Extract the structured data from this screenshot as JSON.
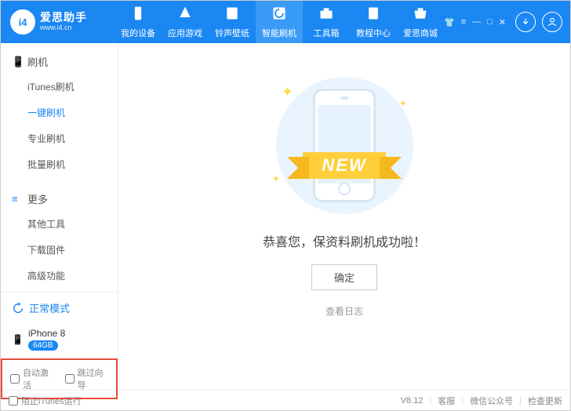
{
  "brand": {
    "logo_text": "i4",
    "name": "爱思助手",
    "url": "www.i4.cn"
  },
  "nav": [
    {
      "label": "我的设备",
      "icon": "device"
    },
    {
      "label": "应用游戏",
      "icon": "app"
    },
    {
      "label": "铃声壁纸",
      "icon": "music"
    },
    {
      "label": "智能刷机",
      "icon": "flash",
      "active": true
    },
    {
      "label": "工具箱",
      "icon": "toolbox"
    },
    {
      "label": "教程中心",
      "icon": "book"
    },
    {
      "label": "爱思商城",
      "icon": "shop"
    }
  ],
  "sidebar": {
    "sections": [
      {
        "title": "刷机",
        "items": [
          "iTunes刷机",
          "一键刷机",
          "专业刷机",
          "批量刷机"
        ],
        "active_index": 1
      },
      {
        "title": "更多",
        "items": [
          "其他工具",
          "下载固件",
          "高级功能"
        ]
      }
    ],
    "mode": "正常模式",
    "device": {
      "name": "iPhone 8",
      "storage": "64GB"
    },
    "checks": {
      "auto_activate": "自动激活",
      "skip_guide": "跳过向导"
    }
  },
  "main": {
    "ribbon": "NEW",
    "congrats": "恭喜您，保资料刷机成功啦！",
    "ok": "确定",
    "view_log": "查看日志"
  },
  "status": {
    "block_itunes": "阻止iTunes运行",
    "version": "V8.12",
    "right": [
      "客服",
      "微信公众号",
      "检查更新"
    ]
  }
}
